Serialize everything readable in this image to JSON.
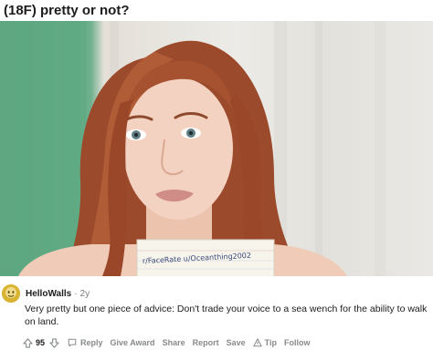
{
  "post": {
    "title": "(18F) pretty or not?",
    "photo_sign_text": "r/FaceRate u/Oceanthing2002"
  },
  "comment": {
    "username": "HelloWalls",
    "separator": "·",
    "age": "2y",
    "text": "Very pretty but one piece of advice: Don't trade your voice to a sea wench for the ability to walk on land.",
    "upvotes": "95",
    "actions": {
      "reply": "Reply",
      "give_award": "Give Award",
      "share": "Share",
      "report": "Report",
      "save": "Save",
      "tip": "Tip",
      "follow": "Follow"
    }
  },
  "colors": {
    "avatar": "#d9b332",
    "action_text": "#878a8c",
    "text": "#1c1c1c"
  },
  "icons": [
    "upvote-icon",
    "downvote-icon",
    "reply-icon",
    "tip-icon"
  ]
}
